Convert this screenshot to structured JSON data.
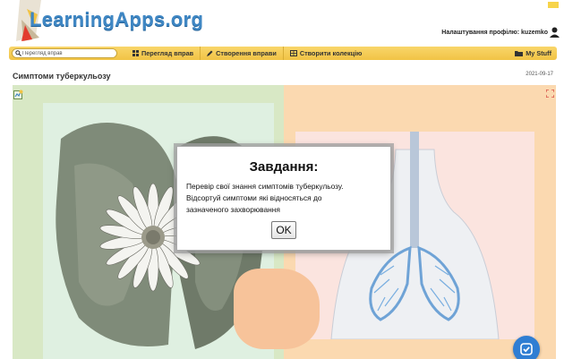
{
  "header": {
    "logo_text": "LearningApps.org",
    "profile_text": "Налаштування профілю: kuzemko"
  },
  "toolbar": {
    "search_placeholder": "Перегляд вправ",
    "nav": [
      {
        "label": "Перегляд вправ",
        "icon": "grid-icon"
      },
      {
        "label": "Створення вправи",
        "icon": "pencil-icon"
      },
      {
        "label": "Створити колекцію",
        "icon": "collection-icon"
      }
    ],
    "my_stuff": "My Stuff"
  },
  "page": {
    "title": "Симптоми туберкульозу",
    "date": "2021-09-17"
  },
  "modal": {
    "title": "Завдання:",
    "line1": "Перевір свої знання симптомів туберкульозу.",
    "line2": "Відсортуй симптоми які відносяться до",
    "line3": "зазначеного захворювання",
    "ok_label": "OK"
  },
  "colors": {
    "toolbar": "#f1c345",
    "logo": "#3f87c4",
    "left_area": "#d8e8c5",
    "right_area": "#fbd9b0",
    "check_button": "#2f7ed3"
  }
}
